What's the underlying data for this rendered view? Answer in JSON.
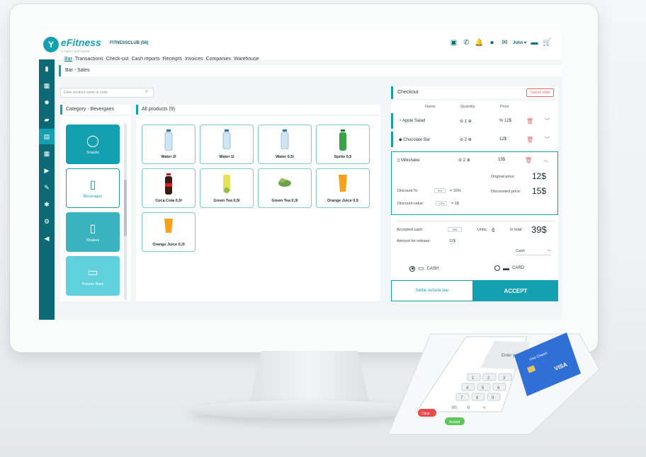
{
  "app": {
    "logo": "eFitness",
    "logo_sub": "FITNESS SOFTWARE",
    "club": "FITNESSCLUB (56)",
    "user": "John ▾"
  },
  "nav": {
    "tabs": [
      "Bar",
      "Transactions",
      "Check-out",
      "Cash reports",
      "Receipts",
      "Invoices",
      "Companies",
      "Warehouse"
    ]
  },
  "breadcrumb": "Bar - Sales",
  "search": {
    "placeholder": "Enter product name or code"
  },
  "categories": {
    "title": "Category - Bevergaes",
    "items": [
      "Snacks",
      "Beverages",
      "Shakes",
      "Protein Bars"
    ]
  },
  "products": {
    "title": "All products (9)",
    "items": [
      "Water 2l",
      "Water 1l",
      "Water 0,5l",
      "Sprite 0,5",
      "Coca Cola 0,5l",
      "Green Tea 0,5l",
      "Green Tea 0,3l",
      "Orange Juice 0,5",
      "Orange Juice 0,3l"
    ]
  },
  "checkout": {
    "title": "Checkout",
    "cancel": "Cancel order",
    "cols": {
      "name": "Name",
      "quantity": "Quantity",
      "price": "Price"
    },
    "items": [
      {
        "name": "Apple Salad",
        "qty": "1",
        "price": "% 12$"
      },
      {
        "name": "Chocolate Bar",
        "qty": "2",
        "price": "12$"
      },
      {
        "name": "Milkshake",
        "qty": "2",
        "price": "15$"
      }
    ],
    "original_label": "Original price:",
    "original_value": "12$",
    "discount_pct_label": "Discount %:",
    "discount_pct_value": "8%",
    "discount_pct_note": "= 10%",
    "discounted_label": "Discounted price:",
    "discounted_value": "15$",
    "discount_val_label": "Discount value:",
    "discount_val_value": "0,5%",
    "discount_val_note": "= 1$",
    "accepted_label": "Accepted cash:",
    "accepted_value": "50$",
    "units_label": "Units:",
    "units_value": "6",
    "total_label": "In total:",
    "total_value": "39$",
    "release_label": "Amount for release:",
    "release_value": "11$",
    "payment_select": "Cash",
    "cash_label": "CASH",
    "card_label": "CARD",
    "settle": "Settle outside bar",
    "accept": "ACCEPT"
  },
  "terminal": {
    "screen_text": "Enter your PIN",
    "card_brand": "VISA",
    "card_holder": "Visa Classic",
    "clear": "Clear",
    "accept": "Accept",
    "keys": [
      "1",
      "2",
      "3",
      "4",
      "5",
      "6",
      "7",
      "8",
      "9",
      "00",
      "0",
      "<"
    ]
  },
  "colors": {
    "accent": "#14a0af",
    "sidebar": "#0b6a76",
    "danger": "#e06a6a"
  }
}
